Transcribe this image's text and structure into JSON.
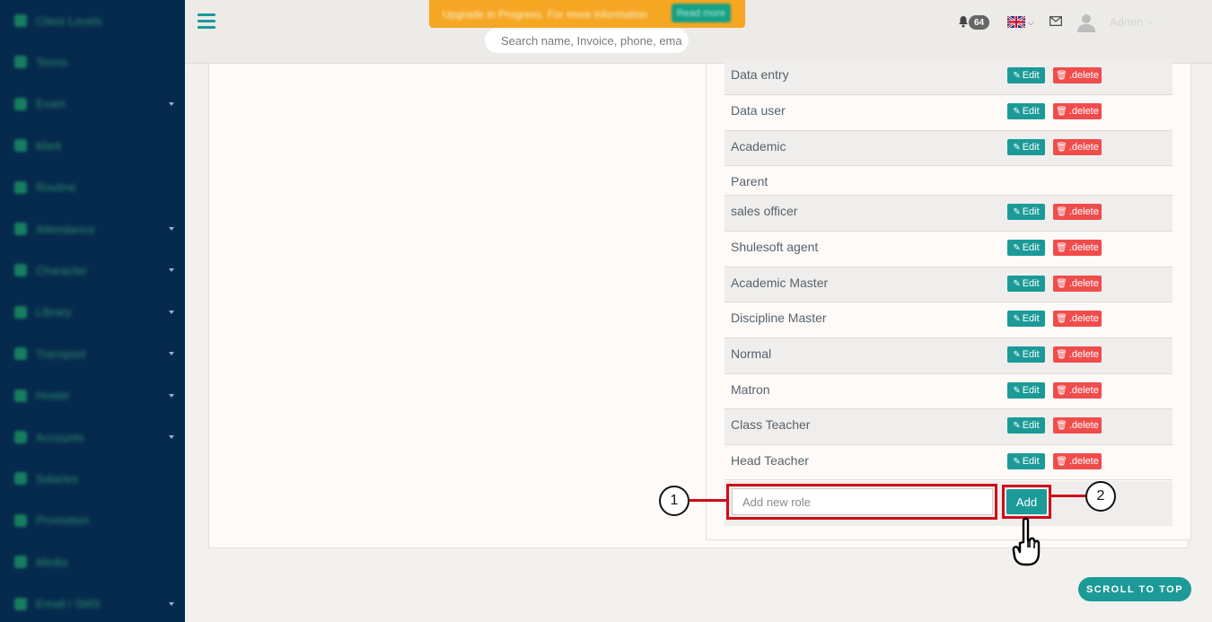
{
  "sidebar": {
    "items": [
      {
        "label": "Class Levels",
        "icon": "dot-icon",
        "has_caret": false
      },
      {
        "label": "Terms",
        "icon": "chart-icon",
        "has_caret": false
      },
      {
        "label": "Exam",
        "icon": "book-icon",
        "has_caret": true
      },
      {
        "label": "Mark",
        "icon": "user-icon",
        "has_caret": false
      },
      {
        "label": "Routine",
        "icon": "circle-icon",
        "has_caret": false
      },
      {
        "label": "Attendance",
        "icon": "check-icon",
        "has_caret": true
      },
      {
        "label": "Character",
        "icon": "edit-icon",
        "has_caret": true
      },
      {
        "label": "Library",
        "icon": "book-icon",
        "has_caret": true
      },
      {
        "label": "Transport",
        "icon": "bus-icon",
        "has_caret": true
      },
      {
        "label": "Hostel",
        "icon": "bed-icon",
        "has_caret": true
      },
      {
        "label": "Accounts",
        "icon": "money-icon",
        "has_caret": true
      },
      {
        "label": "Salaries",
        "icon": "wallet-icon",
        "has_caret": false
      },
      {
        "label": "Promotion",
        "icon": "arrow-icon",
        "has_caret": false
      },
      {
        "label": "Media",
        "icon": "media-icon",
        "has_caret": false
      },
      {
        "label": "Email / SMS",
        "icon": "mail-icon",
        "has_caret": true
      }
    ]
  },
  "header": {
    "upgrade_text": "Upgrade in Progress. For more information",
    "upgrade_button": "Read more",
    "search_placeholder": "Search name, Invoice, phone, ema",
    "notification_count": "64",
    "admin_name": "Admin",
    "language_flag": "uk-flag-icon"
  },
  "roles": [
    {
      "name": "Data entry",
      "actions": true
    },
    {
      "name": "Data user",
      "actions": true
    },
    {
      "name": "Academic",
      "actions": true
    },
    {
      "name": "Parent",
      "actions": false
    },
    {
      "name": "sales officer",
      "actions": true
    },
    {
      "name": "Shulesoft agent",
      "actions": true
    },
    {
      "name": "Academic Master",
      "actions": true
    },
    {
      "name": "Discipline Master",
      "actions": true
    },
    {
      "name": "Normal",
      "actions": true
    },
    {
      "name": "Matron",
      "actions": true
    },
    {
      "name": "Class Teacher",
      "actions": true
    },
    {
      "name": "Head Teacher",
      "actions": true
    }
  ],
  "labels": {
    "edit": "Edit",
    "delete": ".delete",
    "add_placeholder": "Add new role",
    "add_button": "Add",
    "scroll_top": "SCROLL TO TOP"
  },
  "annotations": {
    "callout_1": "1",
    "callout_2": "2"
  },
  "colors": {
    "sidebar_bg": "#062a4d",
    "accent": "#1b9a98",
    "danger": "#f04c4c",
    "banner": "#f5a623",
    "highlight": "#d10a1a"
  }
}
